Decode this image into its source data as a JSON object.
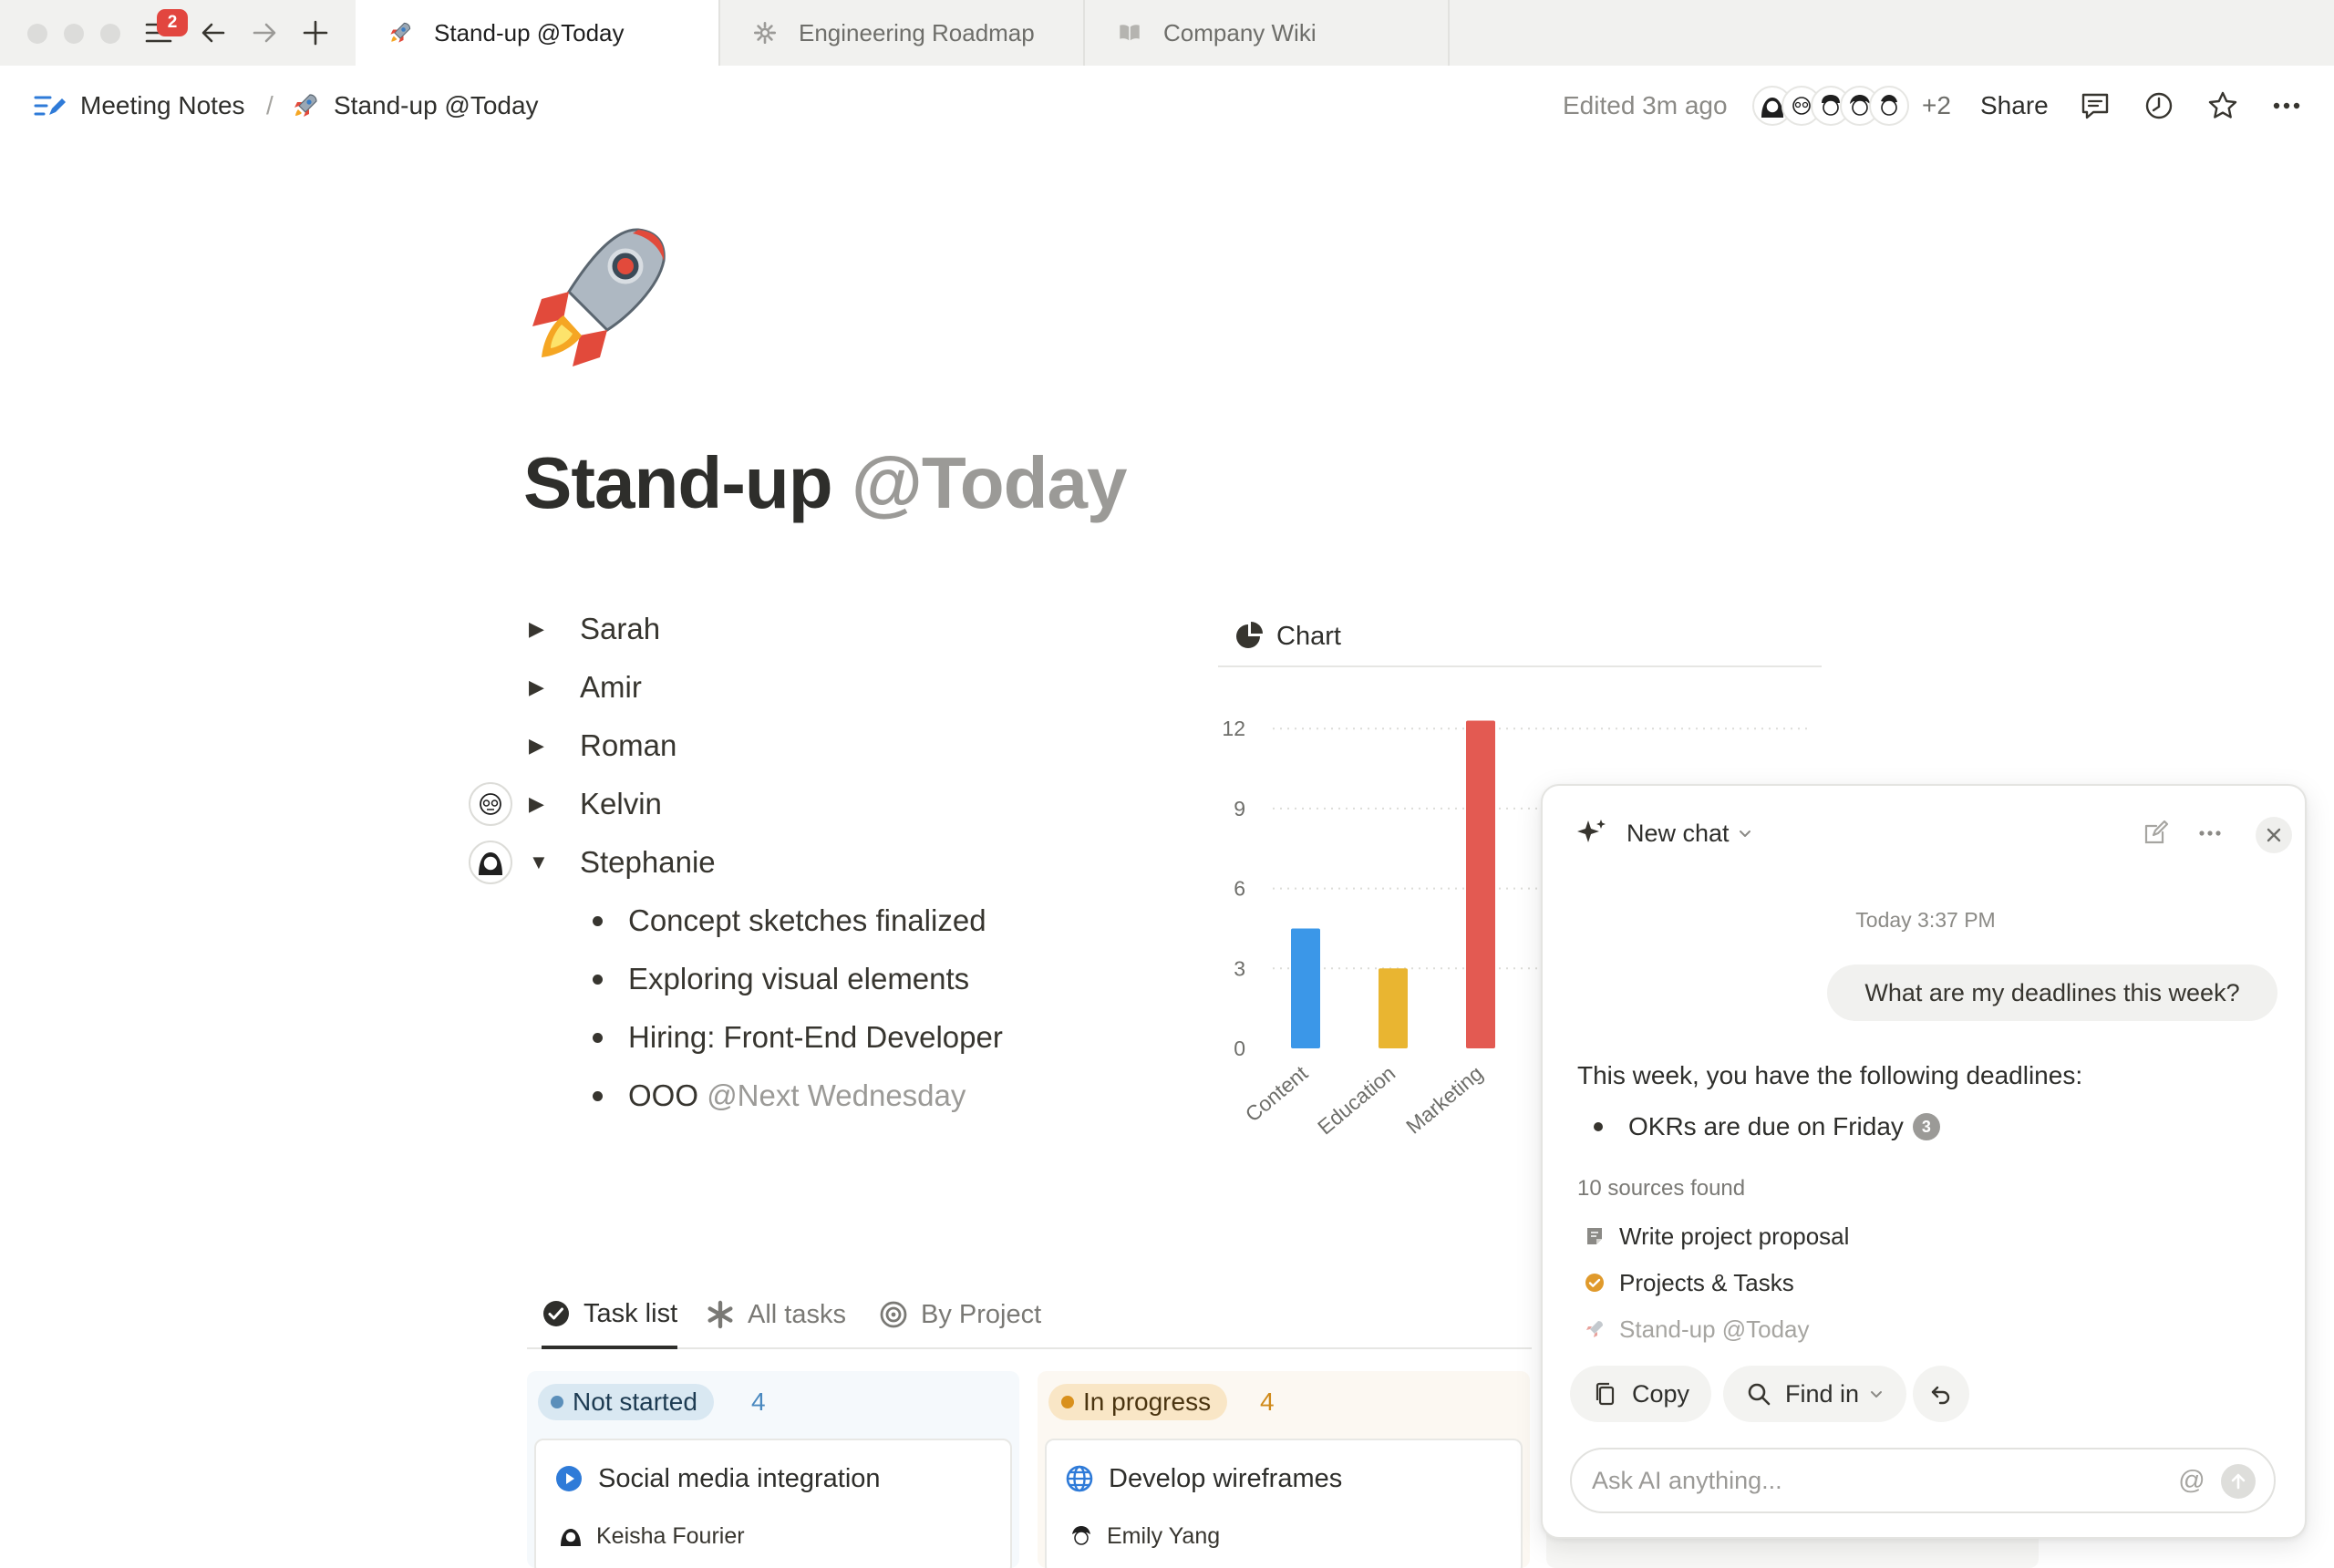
{
  "window": {
    "notification_count": "2"
  },
  "tabs": [
    {
      "label": "Stand-up @Today",
      "icon": "rocket-icon",
      "active": true
    },
    {
      "label": "Engineering Roadmap",
      "icon": "gear-icon",
      "active": false
    },
    {
      "label": "Company Wiki",
      "icon": "book-icon",
      "active": false
    }
  ],
  "breadcrumb": {
    "parent": "Meeting Notes",
    "separator": "/",
    "current": "Stand-up @Today"
  },
  "topbar": {
    "edited": "Edited 3m ago",
    "extra_collaborators": "+2",
    "share_label": "Share"
  },
  "page": {
    "title_main": "Stand-up",
    "title_mention": "@Today",
    "toggles": [
      "Sarah",
      "Amir",
      "Roman",
      "Kelvin",
      "Stephanie"
    ],
    "stephanie_items": [
      "Concept sketches finalized",
      "Exploring visual elements",
      "Hiring: Front-End Developer"
    ],
    "ooo_text": "OOO",
    "ooo_mention": "@Next Wednesday"
  },
  "chart": {
    "header_label": "Chart"
  },
  "chart_data": {
    "type": "bar",
    "categories": [
      "Content",
      "Education",
      "Marketing"
    ],
    "values": [
      4.5,
      3,
      12.3
    ],
    "colors": [
      "#3b97e8",
      "#e9b531",
      "#e35a52"
    ],
    "yticks": [
      0,
      3,
      6,
      9,
      12
    ],
    "ylim": [
      0,
      13
    ]
  },
  "views": {
    "task_list": "Task list",
    "all_tasks": "All tasks",
    "by_project": "By Project"
  },
  "board": {
    "columns": [
      {
        "status": "Not started",
        "count": "4",
        "card_title": "Social media integration",
        "card_person": "Keisha Fourier"
      },
      {
        "status": "In progress",
        "count": "4",
        "card_title": "Develop wireframes",
        "card_person": "Emily Yang"
      }
    ]
  },
  "ai": {
    "title": "New chat",
    "timestamp": "Today 3:37 PM",
    "user_message": "What are my deadlines this week?",
    "answer_intro": "This week, you have the following deadlines:",
    "answer_item": "OKRs are due on Friday",
    "citation": "3",
    "sources_label": "10 sources found",
    "sources": [
      "Write project proposal",
      "Projects & Tasks",
      "Stand-up @Today"
    ],
    "copy_label": "Copy",
    "find_label": "Find in",
    "input_placeholder": "Ask AI anything...",
    "at_symbol": "@"
  }
}
